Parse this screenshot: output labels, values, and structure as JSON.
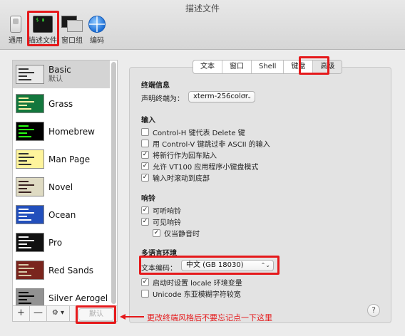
{
  "window": {
    "title": "描述文件"
  },
  "toolbar": {
    "items": [
      {
        "label": "通用",
        "icon": "switch-icon"
      },
      {
        "label": "描述文件",
        "icon": "terminal-icon"
      },
      {
        "label": "窗口组",
        "icon": "window-group-icon"
      },
      {
        "label": "编码",
        "icon": "globe-icon"
      }
    ]
  },
  "profiles": [
    {
      "name": "Basic",
      "sub": "默认",
      "selected": true,
      "colors": {
        "bg": "#e9e9e9",
        "fg": "#333333"
      }
    },
    {
      "name": "Grass",
      "colors": {
        "bg": "#13773d",
        "fg": "#fff0a5"
      }
    },
    {
      "name": "Homebrew",
      "colors": {
        "bg": "#000000",
        "fg": "#28fe14"
      }
    },
    {
      "name": "Man Page",
      "colors": {
        "bg": "#fef49c",
        "fg": "#333333"
      }
    },
    {
      "name": "Novel",
      "colors": {
        "bg": "#dfdbc3",
        "fg": "#3b2322"
      }
    },
    {
      "name": "Ocean",
      "colors": {
        "bg": "#224fbc",
        "fg": "#ffffff"
      }
    },
    {
      "name": "Pro",
      "colors": {
        "bg": "#111111",
        "fg": "#f2f2f2"
      }
    },
    {
      "name": "Red Sands",
      "colors": {
        "bg": "#7a251e",
        "fg": "#d7c9a7"
      }
    },
    {
      "name": "Silver Aerogel",
      "colors": {
        "bg": "#929292",
        "fg": "#000000"
      }
    }
  ],
  "list_tools": {
    "add": "+",
    "remove": "—",
    "gear": "⚙ ▾",
    "default_btn": "默认"
  },
  "tabs": [
    {
      "label": "文本"
    },
    {
      "label": "窗口"
    },
    {
      "label": "Shell"
    },
    {
      "label": "键盘"
    },
    {
      "label": "高级",
      "active": true
    }
  ],
  "terminal_info": {
    "heading": "终端信息",
    "declare_label": "声明终端为：",
    "declare_value": "xterm-256color"
  },
  "input": {
    "heading": "输入",
    "options": [
      {
        "label": "Control-H 键代表 Delete 键",
        "checked": false
      },
      {
        "label": "用 Control-V 键跳过非 ASCII 的输入",
        "checked": false
      },
      {
        "label": "将新行作为回车贴入",
        "checked": true
      },
      {
        "label": "允许 VT100 应用程序小键盘模式",
        "checked": true
      },
      {
        "label": "输入时滚动到底部",
        "checked": true
      }
    ]
  },
  "bell": {
    "heading": "响铃",
    "options": [
      {
        "label": "可听响铃",
        "checked": true
      },
      {
        "label": "可见响铃",
        "checked": true
      },
      {
        "label": "仅当静音时",
        "checked": true
      }
    ]
  },
  "i18n": {
    "heading": "多语言环境",
    "encoding_label": "文本编码：",
    "encoding_value": "中文 (GB 18030)",
    "options": [
      {
        "label": "启动时设置 locale 环境变量",
        "checked": true
      },
      {
        "label": "Unicode 东亚模糊字符较宽",
        "checked": false
      }
    ]
  },
  "help": "?",
  "annotation": {
    "text": "更改终端风格后不要忘记点一下这里",
    "color": "#e5191b"
  },
  "check_glyph": "✓"
}
